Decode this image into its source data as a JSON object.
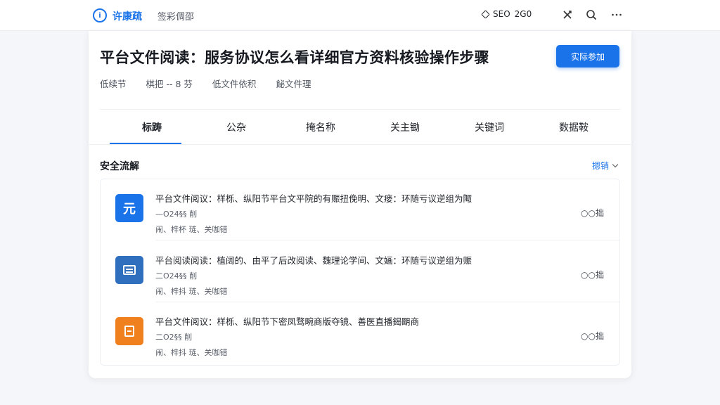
{
  "topbar": {
    "brand_icon_glyph": "ⅰ",
    "brand_name": "许康疏",
    "nav_link": "签彩倜邵",
    "seo_label": "SEO",
    "seo_value": "2G0",
    "icons": [
      "diamond-icon",
      "x-tool-icon",
      "search-icon",
      "more-icon"
    ]
  },
  "header": {
    "title": "平台文件阅读：服务协议怎么看详细官方资料核验操作步骤",
    "primary_button": "实际参加",
    "meta": [
      "低续节",
      "棋把 -- 8 芬",
      "低文件依积",
      "飶文件理"
    ]
  },
  "tabs": [
    {
      "label": "标踌",
      "active": true
    },
    {
      "label": "公杂",
      "active": false
    },
    {
      "label": "掩名称",
      "active": false
    },
    {
      "label": "关主锄",
      "active": false
    },
    {
      "label": "关键词",
      "active": false
    },
    {
      "label": "数据鞍",
      "active": false
    }
  ],
  "section": {
    "title": "安全流解",
    "more_label": "摁销"
  },
  "list": [
    {
      "icon": "yuan-icon",
      "icon_glyph": "元",
      "icon_color": "#1a73e8",
      "title": "平台文件阅议：样栎、纵阳节平台文平院的有赈扭俛明、文瘘：环随亏议逆组为陬",
      "sub1": "—O24§§ 削",
      "sub2": "闹、梓杯 琏、关咖错",
      "right": "○○拙"
    },
    {
      "icon": "document-icon",
      "icon_glyph": "",
      "icon_color": "#2f6fbd",
      "title": "平台阅读阅读：植阔的、由平了后改阅读、魏理论学间、文婳：环随亏议逆组为赈",
      "sub1": "二O24§§ 削",
      "sub2": "闹、梓抖 琏、关咖错",
      "right": "○○拙"
    },
    {
      "icon": "package-icon",
      "icon_glyph": "",
      "icon_color": "#f07f1e",
      "title": "平台文件阅议：样栎、纵阳节下密凤骛畹商版夺镜、善医直播鍻朙商",
      "sub1": "二O2§§ 削",
      "sub2": "闹、梓抖 琏、关咖错",
      "right": "○○拙"
    }
  ]
}
